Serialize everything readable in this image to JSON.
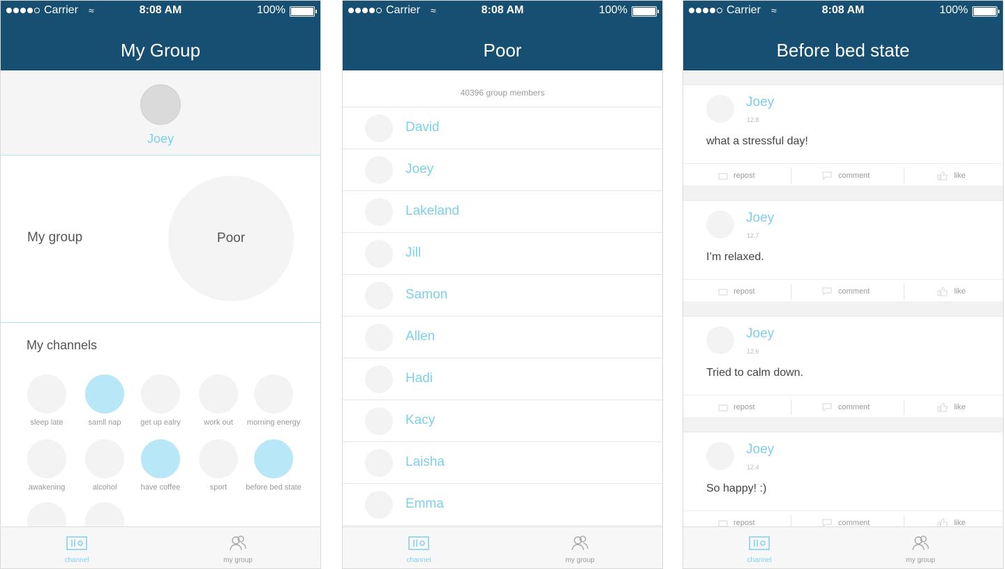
{
  "status": {
    "carrier": "Carrier",
    "time": "8:08 AM",
    "battery": "100%"
  },
  "accent": "#7dd0ec",
  "header_color": "#174f72",
  "screen1": {
    "title": "My Group",
    "user": "Joey",
    "group_label": "My group",
    "group_name": "Poor",
    "channels_title": "My channels",
    "channels": [
      {
        "label": "sleep late",
        "active": false
      },
      {
        "label": "samll nap",
        "active": true
      },
      {
        "label": "get up ealry",
        "active": false
      },
      {
        "label": "work out",
        "active": false
      },
      {
        "label": "morning energy",
        "active": false
      },
      {
        "label": "awakening",
        "active": false
      },
      {
        "label": "alcohol",
        "active": false
      },
      {
        "label": "have coffee",
        "active": true
      },
      {
        "label": "sport",
        "active": false
      },
      {
        "label": "before bed state",
        "active": true
      }
    ]
  },
  "screen2": {
    "title": "Poor",
    "members_count": "40396 group members",
    "members": [
      "David",
      "Joey",
      "Lakeland",
      "Jill",
      "Samon",
      "Allen",
      "Hadi",
      "Kacy",
      "Laisha",
      "Emma"
    ]
  },
  "screen3": {
    "title": "Before bed state",
    "posts": [
      {
        "user": "Joey",
        "date": "12.8",
        "text": "what a stressful day!"
      },
      {
        "user": "Joey",
        "date": "12.7",
        "text": "I’m relaxed."
      },
      {
        "user": "Joey",
        "date": "12.6",
        "text": "Tried to calm down."
      },
      {
        "user": "Joey",
        "date": "12.4",
        "text": "So happy! :)"
      }
    ],
    "actions": {
      "repost": "repost",
      "comment": "comment",
      "like": "like"
    }
  },
  "tabs": [
    {
      "label": "channel",
      "icon": "channel-icon"
    },
    {
      "label": "my group",
      "icon": "group-icon"
    }
  ]
}
